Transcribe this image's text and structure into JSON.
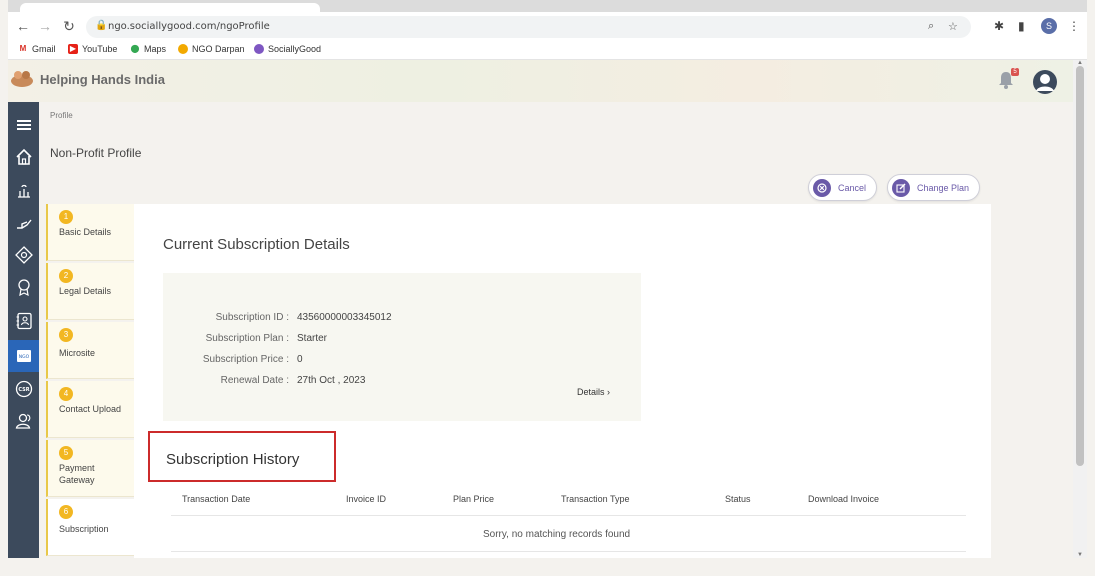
{
  "browser": {
    "url": "ngo.sociallygood.com/ngoProfile",
    "profile_initial": "S",
    "bookmarks": [
      {
        "label": "Gmail",
        "color": "#d93025",
        "icon": "M"
      },
      {
        "label": "YouTube",
        "color": "#e62117",
        "icon": "▶"
      },
      {
        "label": "Maps",
        "color": "#34a853",
        "icon": "⬤"
      },
      {
        "label": "NGO Darpan",
        "color": "#f2a900",
        "icon": "●"
      },
      {
        "label": "SociallyGood",
        "color": "#7e57c2",
        "icon": "◆"
      }
    ]
  },
  "header": {
    "org_name": "Helping Hands India",
    "notification_count": "5"
  },
  "sidebar": {
    "items": [
      {
        "icon": "menu-icon"
      },
      {
        "icon": "home-icon"
      },
      {
        "icon": "charity-icon"
      },
      {
        "icon": "donate-icon"
      },
      {
        "icon": "badge-icon"
      },
      {
        "icon": "award-icon"
      },
      {
        "icon": "contacts-icon"
      },
      {
        "icon": "ngo-icon",
        "active": true
      },
      {
        "icon": "csr-icon"
      },
      {
        "icon": "users-icon"
      }
    ],
    "ngo_label": "NGO",
    "csr_label": "CSR"
  },
  "page": {
    "breadcrumb": "Profile",
    "title": "Non-Profit Profile",
    "cancel_label": "Cancel",
    "change_plan_label": "Change Plan"
  },
  "steps": [
    {
      "num": "1",
      "label": "Basic Details"
    },
    {
      "num": "2",
      "label": "Legal Details"
    },
    {
      "num": "3",
      "label": "Microsite"
    },
    {
      "num": "4",
      "label": "Contact Upload"
    },
    {
      "num": "5",
      "label": "Payment Gateway"
    },
    {
      "num": "6",
      "label": "Subscription"
    }
  ],
  "subscription": {
    "section_title": "Current Subscription Details",
    "rows": [
      {
        "label": "Subscription ID :",
        "value": "43560000003345012"
      },
      {
        "label": "Subscription Plan :",
        "value": "Starter"
      },
      {
        "label": "Subscription Price :",
        "value": "0"
      },
      {
        "label": "Renewal Date :",
        "value": "27th Oct , 2023"
      }
    ],
    "details_link": "Details ›"
  },
  "history": {
    "title": "Subscription History",
    "columns": [
      "Transaction Date",
      "Invoice ID",
      "Plan Price",
      "Transaction Type",
      "Status",
      "Download Invoice"
    ],
    "empty_message": "Sorry, no matching records found"
  },
  "colors": {
    "sidebar_bg": "#3c4a5c",
    "sidebar_active": "#2a66b8",
    "accent_purple": "#6a5aa8",
    "step_badge": "#f2b722",
    "highlight_red": "#cc2b2b"
  }
}
